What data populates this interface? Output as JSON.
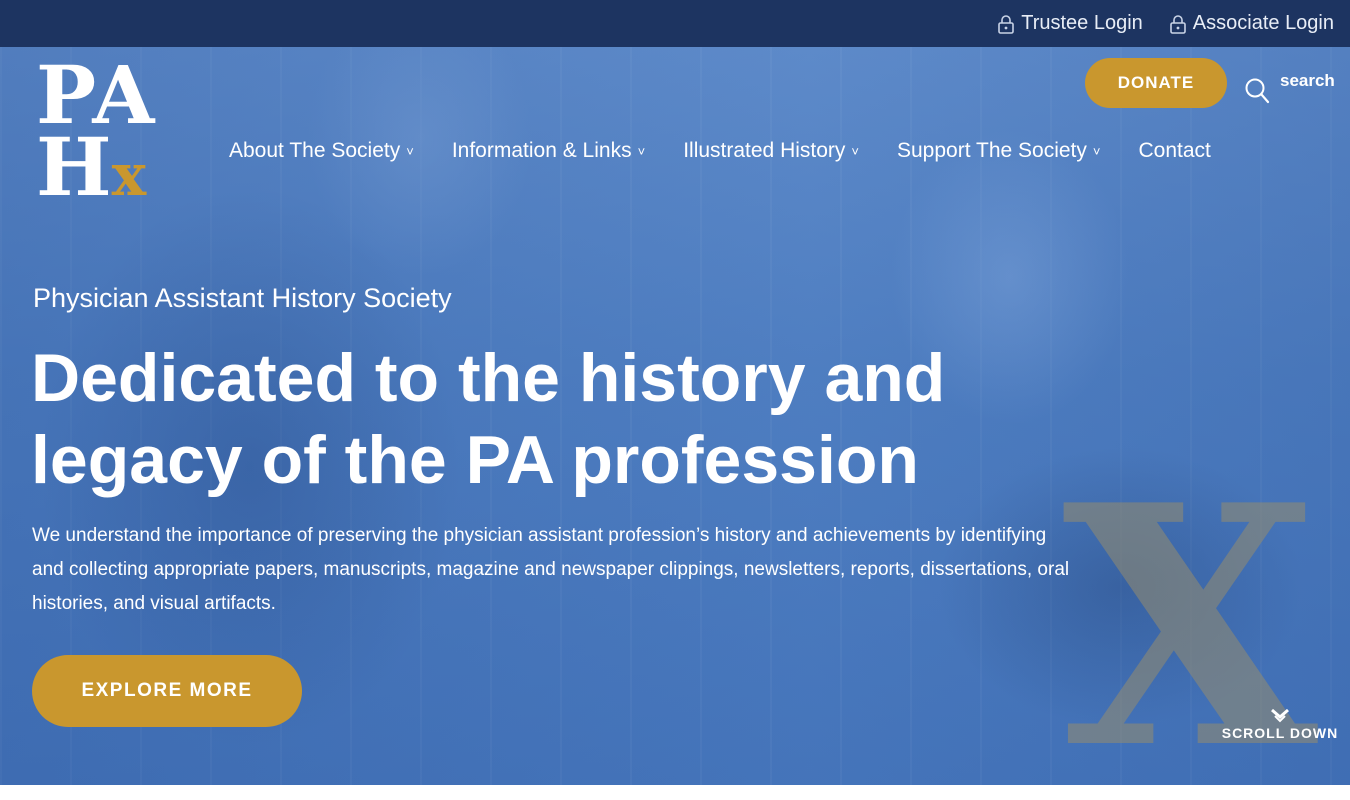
{
  "topbar": {
    "trustee_login": "Trustee Login",
    "associate_login": "Associate Login"
  },
  "logo": {
    "line1": "PA",
    "line2_h": "H",
    "line2_x": "x"
  },
  "header": {
    "donate_label": "DONATE",
    "search_label": "search"
  },
  "nav": {
    "items": [
      {
        "label": "About The Society",
        "chevron": "˅"
      },
      {
        "label": "Information & Links",
        "chevron": "˅"
      },
      {
        "label": "Illustrated History",
        "chevron": "˅"
      },
      {
        "label": "Support The Society",
        "chevron": "˅"
      },
      {
        "label": "Contact"
      }
    ]
  },
  "hero": {
    "eyebrow": "Physician Assistant History Society",
    "headline": "Dedicated to the history and legacy of the PA profession",
    "lead": "We understand the importance of preserving the physician assistant profession’s history and achievements by identifying and collecting appropriate papers, manuscripts, magazine and newspaper clippings, newsletters, reports, dissertations, oral histories, and visual artifacts.",
    "cta_label": "EXPLORE MORE",
    "decor_letter": "X",
    "scroll_label": "SCROLL DOWN"
  },
  "colors": {
    "topbar_bg": "#1d3461",
    "accent_gold": "#c9972e",
    "hero_blue": "#4f7fc2"
  },
  "icons": [
    "lock-icon",
    "search-icon",
    "chevron-down-icon",
    "scroll-down-arrow-icon"
  ]
}
